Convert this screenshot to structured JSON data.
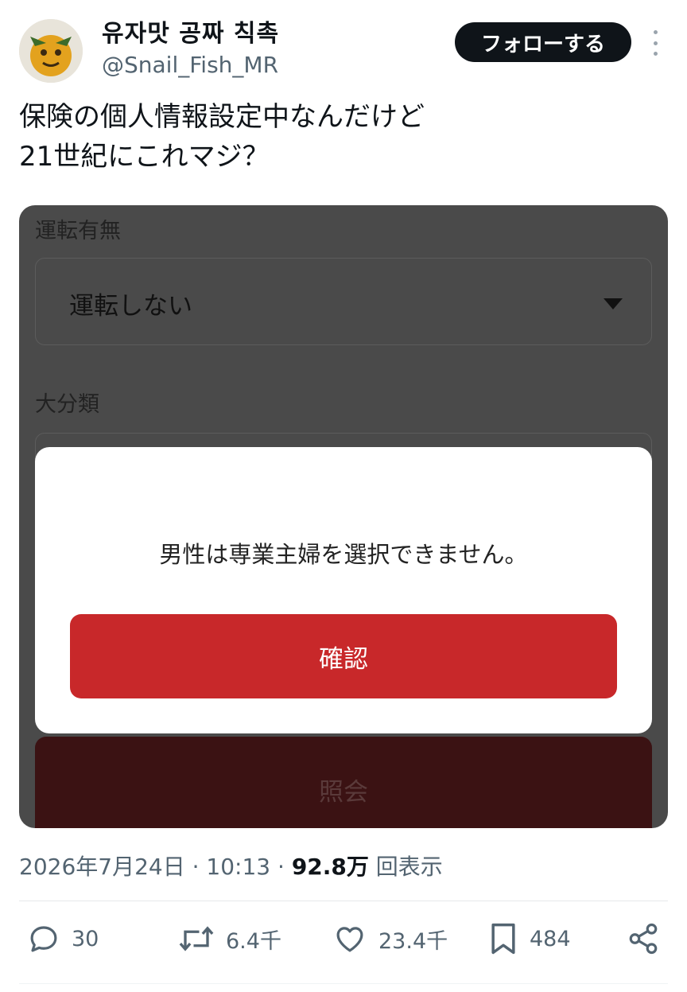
{
  "author": {
    "display_name": "유자맛 공짜 칙촉",
    "handle": "@Snail_Fish_MR",
    "avatar": "citrus-face-avatar"
  },
  "follow_label": "フォローする",
  "more_icon": "more-vertical-icon",
  "tweet": {
    "line1": "保険の個人情報設定中なんだけど",
    "line2": "21世紀にこれマジ？"
  },
  "screenshot": {
    "label_driving": "運転有無",
    "select_value": "運転しない",
    "label_category": "大分類",
    "dialog_message": "男性は専業主婦を選択できません。",
    "confirm_label": "確認",
    "submit_label": "照会",
    "colors": {
      "confirm": "#c8282a",
      "submit_dim": "#3b1213",
      "overlay": "#4a4a4a"
    }
  },
  "meta": {
    "date": "2026年7月24日",
    "sep1": " · ",
    "time": "10:13",
    "sep2": " · ",
    "views_count": "92.8万",
    "views_label": " 回表示"
  },
  "actions": {
    "reply": {
      "icon": "reply-icon",
      "count": "30"
    },
    "retweet": {
      "icon": "retweet-icon",
      "count": "6.4千"
    },
    "like": {
      "icon": "heart-icon",
      "count": "23.4千"
    },
    "bookmark": {
      "icon": "bookmark-icon",
      "count": "484"
    },
    "share": {
      "icon": "share-icon"
    }
  }
}
